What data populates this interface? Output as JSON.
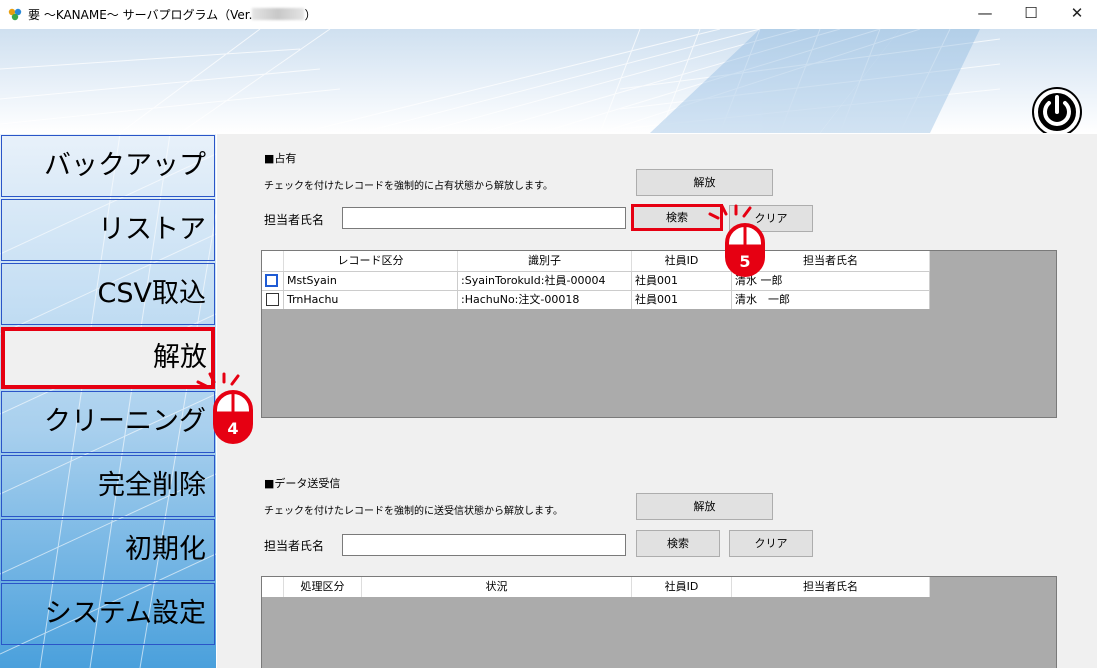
{
  "window": {
    "title": "要 〜KANAME〜 サーバプログラム（Ver.",
    "minimize": "—",
    "maximize": "☐",
    "close": "✕"
  },
  "sidebar": {
    "items": [
      {
        "label": "バックアップ"
      },
      {
        "label": "リストア"
      },
      {
        "label": "CSV取込"
      },
      {
        "label": "解放"
      },
      {
        "label": "クリーニング"
      },
      {
        "label": "完全削除"
      },
      {
        "label": "初期化"
      },
      {
        "label": "システム設定"
      }
    ],
    "selected": "解放"
  },
  "occupied": {
    "section_title": "■占有",
    "description": "チェックを付けたレコードを強制的に占有状態から解放します。",
    "release_button": "解放",
    "person_label": "担当者氏名",
    "person_value": "",
    "search_button": "検索",
    "clear_button": "クリア",
    "columns": [
      "レコード区分",
      "識別子",
      "社員ID",
      "担当者氏名"
    ],
    "rows": [
      {
        "checked": false,
        "record_type": "MstSyain",
        "identifier": ":SyainTorokuId:社員-00004",
        "employee_id": "社員001",
        "person": "清水 一郎"
      },
      {
        "checked": false,
        "record_type": "TrnHachu",
        "identifier": ":HachuNo:注文-00018",
        "employee_id": "社員001",
        "person": "清水　一郎"
      }
    ]
  },
  "transfer": {
    "section_title": "■データ送受信",
    "description": "チェックを付けたレコードを強制的に送受信状態から解放します。",
    "release_button": "解放",
    "person_label": "担当者氏名",
    "person_value": "",
    "search_button": "検索",
    "clear_button": "クリア",
    "columns": [
      "処理区分",
      "状況",
      "社員ID",
      "担当者氏名"
    ]
  },
  "callouts": {
    "step4": "4",
    "step5": "5"
  },
  "colors": {
    "highlight": "#e60012",
    "sidebar_border": "#2a55c8",
    "panel_bg": "#f0f0f0"
  }
}
